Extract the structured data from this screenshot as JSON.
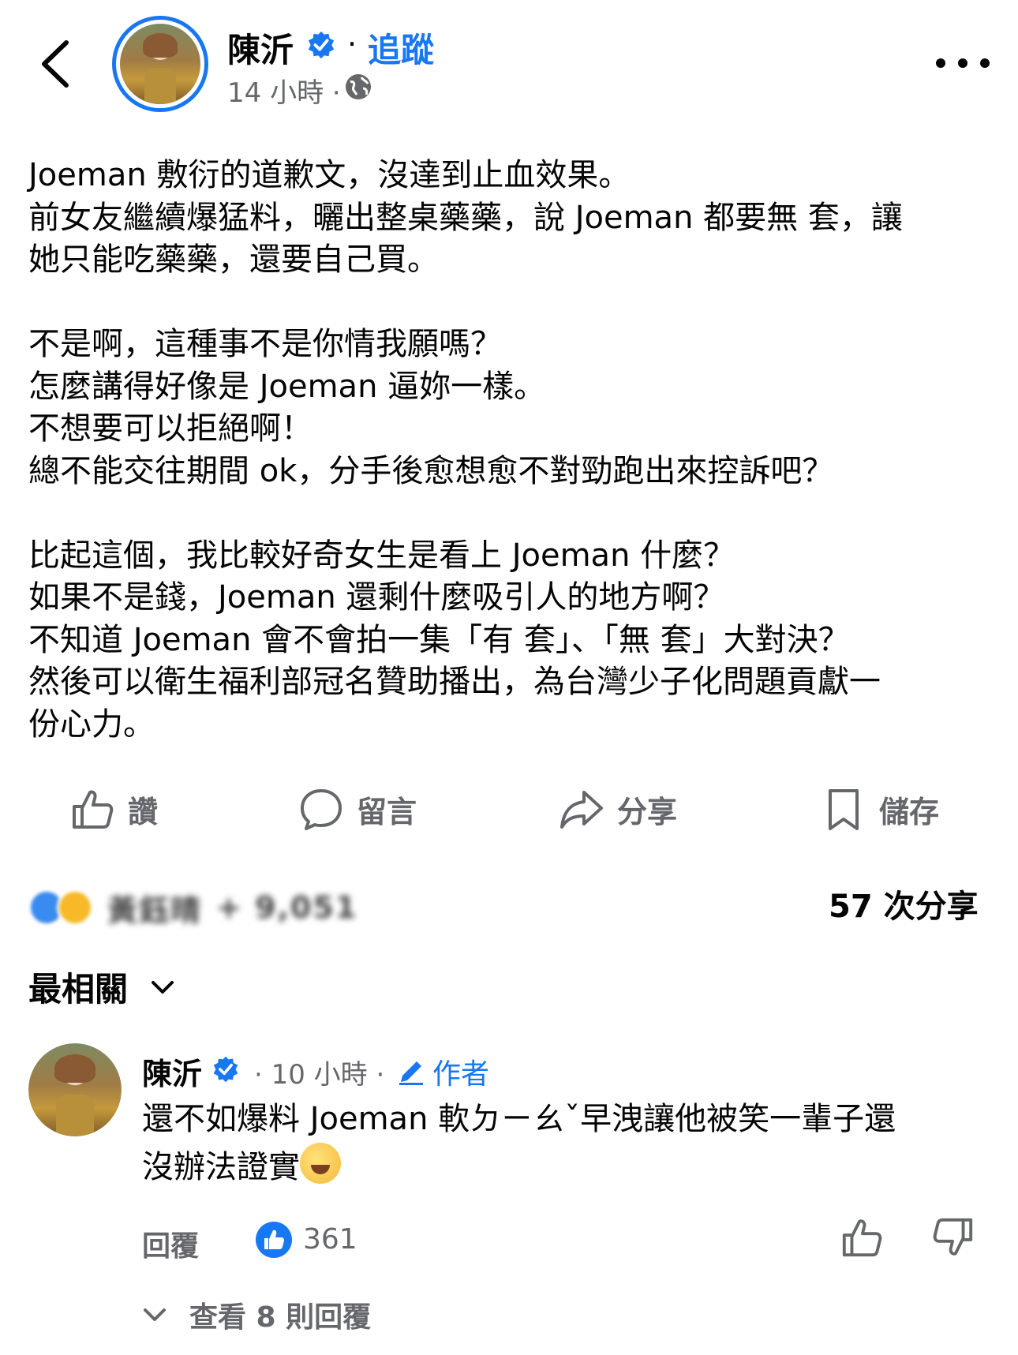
{
  "header": {
    "author_name": "陳沂",
    "separator": "·",
    "follow_label": "追蹤",
    "time": "14 小時 ·"
  },
  "post": {
    "lines": [
      "Joeman 敷衍的道歉文，沒達到止血效果。",
      "前女友繼續爆猛料，曬出整桌藥藥，說 Joeman 都要無 套，讓",
      "她只能吃藥藥，還要自己買。",
      "",
      "不是啊，這種事不是你情我願嗎？",
      "怎麼講得好像是 Joeman 逼妳一樣。",
      "不想要可以拒絕啊！",
      "總不能交往期間 ok，分手後愈想愈不對勁跑出來控訴吧？",
      "",
      "比起這個，我比較好奇女生是看上 Joeman 什麼？",
      "如果不是錢，Joeman 還剩什麼吸引人的地方啊？",
      "不知道 Joeman 會不會拍一集「有 套」、「無 套」大對決？",
      "然後可以衛生福利部冠名贊助播出，為台灣少子化問題貢獻一",
      "份心力。"
    ]
  },
  "actions": {
    "like": "讚",
    "comment": "留言",
    "share": "分享",
    "save": "儲存"
  },
  "reactions": {
    "names_blurred": "黃鈺晴",
    "count_blurred": "+ 9,051",
    "shares": "57 次分享"
  },
  "sort": {
    "label": "最相關"
  },
  "comment": {
    "author": "陳沂",
    "time": "· 10 小時 ·",
    "author_badge": "作者",
    "text_line1": "還不如爆料 Joeman 軟ㄉㄧㄠˇ早洩讓他被笑一輩子還",
    "text_line2": "沒辦法證實",
    "reply_label": "回覆",
    "like_count": "361",
    "view_replies": "查看 8 則回覆"
  },
  "colors": {
    "brand": "#1877f2",
    "secondary_text": "#65676b",
    "primary_text": "#050505"
  },
  "icons": [
    "back-arrow-icon",
    "verified-icon",
    "globe-icon",
    "more-icon",
    "like-icon",
    "comment-icon",
    "share-icon",
    "save-icon",
    "chevron-down-icon",
    "pencil-icon",
    "thumbs-up-icon",
    "thumbs-down-icon"
  ]
}
